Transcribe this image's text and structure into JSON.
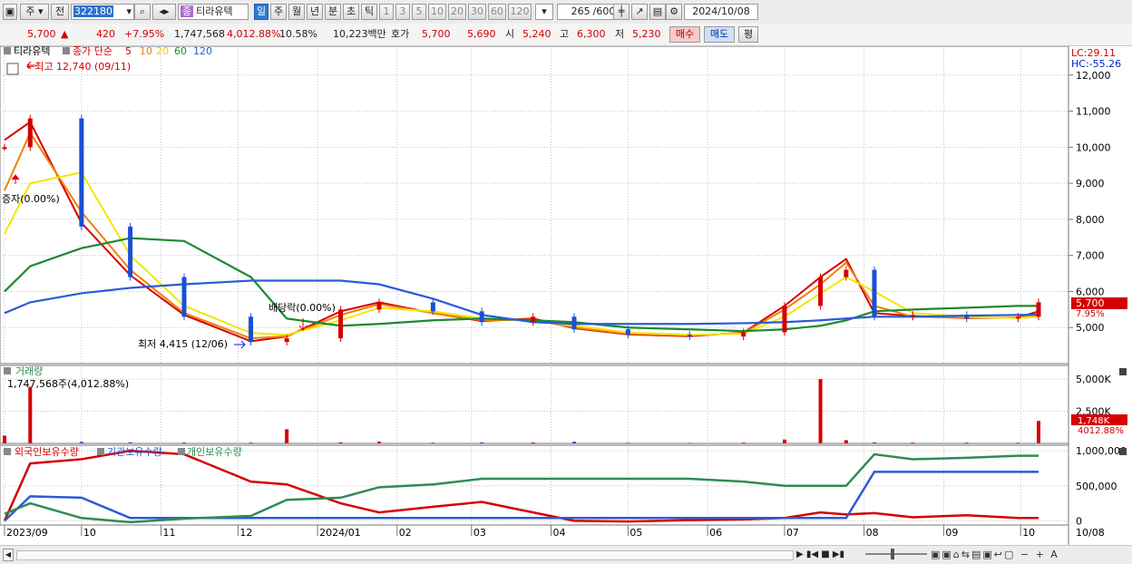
{
  "toolbar": {
    "market_label": "주",
    "scope_label": "전",
    "code_value": "322180",
    "name_badge": "종",
    "stock_name": "티라유텍",
    "periods": [
      "일",
      "주",
      "월",
      "년",
      "분",
      "초",
      "틱"
    ],
    "active_period": "일",
    "intervals": [
      "1",
      "3",
      "5",
      "10",
      "20",
      "30",
      "60",
      "120"
    ],
    "count_value": "265",
    "count_total": "/600",
    "date_value": "2024/10/08"
  },
  "quote": {
    "price": "5,700",
    "change": "420",
    "change_pct": "+7.95%",
    "volume": "1,747,568",
    "volume_ratio": "4,012.88%",
    "turnover": "10.58%",
    "amount": "10,223백만",
    "hoga_label": "호가",
    "ask": "5,700",
    "bid": "5,690",
    "open_label": "시",
    "open": "5,240",
    "high_label": "고",
    "high": "6,300",
    "low_label": "저",
    "low": "5,230",
    "buy_label": "매수",
    "sell_label": "매도",
    "eval_label": "평"
  },
  "colors": {
    "up": "#d40000",
    "down": "#1a4fd6",
    "ma5": "#d40000",
    "ma10": "#f08000",
    "ma20": "#f2e600",
    "ma60": "#1b8a2f",
    "ma120": "#2a5bd7",
    "foreign": "#d40000",
    "institution": "#2a5bd7",
    "individual": "#2e8b57"
  },
  "price_pane": {
    "legend": {
      "name": "티라유텍",
      "type": "종가 단순",
      "ma_periods": [
        "5",
        "10",
        "20",
        "60",
        "120"
      ]
    },
    "max_note": "최고 12,740 (09/11)",
    "min_note": "최저 4,415 (12/06)",
    "event1": "증자(0.00%)",
    "event2": "배당락(0.00%)",
    "lc": "LC:29.11",
    "hc": "HC:-55.26",
    "last_price": "5,700",
    "last_pct": "7.95%"
  },
  "volume_pane": {
    "title": "거래량",
    "value": "1,747,568주(4,012.88%)",
    "last_label": "1,748K",
    "last_pct": "4012.88%"
  },
  "holding_pane": {
    "foreign_label": "외국인보유수량",
    "inst_label": "기관보유수량",
    "indiv_label": "개인보유수량"
  },
  "chart_data": [
    {
      "type": "candlestick",
      "title": "티라유텍 일봉",
      "x": [
        "2023-09-01",
        "2023-09-11",
        "2023-10-01",
        "2023-10-20",
        "2023-11-10",
        "2023-12-06",
        "2023-12-20",
        "2024-01-10",
        "2024-01-25",
        "2024-02-15",
        "2024-03-05",
        "2024-03-25",
        "2024-04-10",
        "2024-05-01",
        "2024-05-25",
        "2024-06-15",
        "2024-07-01",
        "2024-07-15",
        "2024-07-25",
        "2024-08-05",
        "2024-08-20",
        "2024-09-10",
        "2024-09-30",
        "2024-10-08"
      ],
      "close": [
        10000,
        10800,
        7800,
        6400,
        5300,
        4600,
        4700,
        5500,
        5700,
        5450,
        5150,
        5300,
        4950,
        4800,
        4750,
        4870,
        5600,
        6400,
        6600,
        5300,
        5350,
        5250,
        5300,
        5700
      ],
      "y_ticks": [
        5000,
        6000,
        7000,
        8000,
        9000,
        10000,
        11000,
        12000
      ],
      "ylim": [
        4000,
        12800
      ],
      "x_ticks": [
        "2023/09",
        "10",
        "11",
        "12",
        "2024/01",
        "02",
        "03",
        "04",
        "05",
        "06",
        "07",
        "08",
        "09",
        "10",
        "10/08"
      ],
      "max": {
        "date": "2023-09-11",
        "value": 12740
      },
      "min": {
        "date": "2023-12-06",
        "value": 4415
      },
      "series": [
        {
          "name": "5",
          "values": [
            10200,
            10700,
            7900,
            6450,
            5350,
            4620,
            4750,
            5450,
            5700,
            5400,
            5180,
            5250,
            4980,
            4810,
            4760,
            4860,
            5600,
            6400,
            6900,
            5400,
            5320,
            5260,
            5280,
            5450
          ]
        },
        {
          "name": "10",
          "values": [
            8800,
            10400,
            8200,
            6600,
            5400,
            4700,
            4760,
            5350,
            5650,
            5400,
            5200,
            5220,
            5000,
            4830,
            4780,
            4850,
            5500,
            6200,
            6800,
            5600,
            5300,
            5270,
            5270,
            5350
          ]
        },
        {
          "name": "20",
          "values": [
            7600,
            9000,
            9300,
            7000,
            5600,
            4850,
            4800,
            5200,
            5550,
            5450,
            5250,
            5200,
            5050,
            4860,
            4800,
            4830,
            5300,
            5950,
            6400,
            6000,
            5400,
            5300,
            5260,
            5300
          ]
        },
        {
          "name": "60",
          "values": [
            6000,
            6700,
            7200,
            7480,
            7400,
            6400,
            5250,
            5050,
            5100,
            5200,
            5250,
            5200,
            5150,
            5000,
            4950,
            4900,
            4950,
            5050,
            5200,
            5450,
            5500,
            5550,
            5600,
            5600
          ]
        },
        {
          "name": "120",
          "values": [
            5400,
            5700,
            5950,
            6100,
            6200,
            6300,
            6300,
            6300,
            6200,
            5800,
            5350,
            5150,
            5100,
            5100,
            5100,
            5120,
            5150,
            5200,
            5250,
            5300,
            5300,
            5330,
            5350,
            5360
          ]
        }
      ]
    },
    {
      "type": "bar",
      "title": "거래량",
      "y_ticks": [
        2500,
        5000
      ],
      "ylim": [
        0,
        5500
      ],
      "unit": "K",
      "values": [
        600,
        4400,
        120,
        90,
        70,
        60,
        1100,
        80,
        140,
        60,
        80,
        70,
        130,
        50,
        40,
        60,
        300,
        5000,
        250,
        80,
        60,
        60,
        50,
        1748
      ]
    },
    {
      "type": "line",
      "title": "보유수량",
      "y_ticks": [
        0,
        500000,
        1000000
      ],
      "ylim": [
        -60000,
        1080000
      ],
      "series": [
        {
          "name": "외국인보유수량",
          "values": [
            0,
            820000,
            880000,
            1000000,
            950000,
            560000,
            520000,
            250000,
            120000,
            200000,
            270000,
            120000,
            0,
            -10000,
            10000,
            20000,
            40000,
            120000,
            90000,
            110000,
            50000,
            80000,
            40000,
            40000
          ]
        },
        {
          "name": "기관보유수량",
          "values": [
            0,
            350000,
            330000,
            40000,
            40000,
            40000,
            40000,
            40000,
            40000,
            40000,
            40000,
            40000,
            40000,
            40000,
            40000,
            40000,
            40000,
            40000,
            40000,
            700000,
            700000,
            700000,
            700000,
            700000
          ]
        },
        {
          "name": "개인보유수량",
          "values": [
            100000,
            250000,
            40000,
            -20000,
            30000,
            70000,
            300000,
            330000,
            480000,
            520000,
            600000,
            600000,
            600000,
            600000,
            600000,
            560000,
            500000,
            500000,
            500000,
            950000,
            880000,
            900000,
            930000,
            930000
          ]
        }
      ]
    }
  ]
}
